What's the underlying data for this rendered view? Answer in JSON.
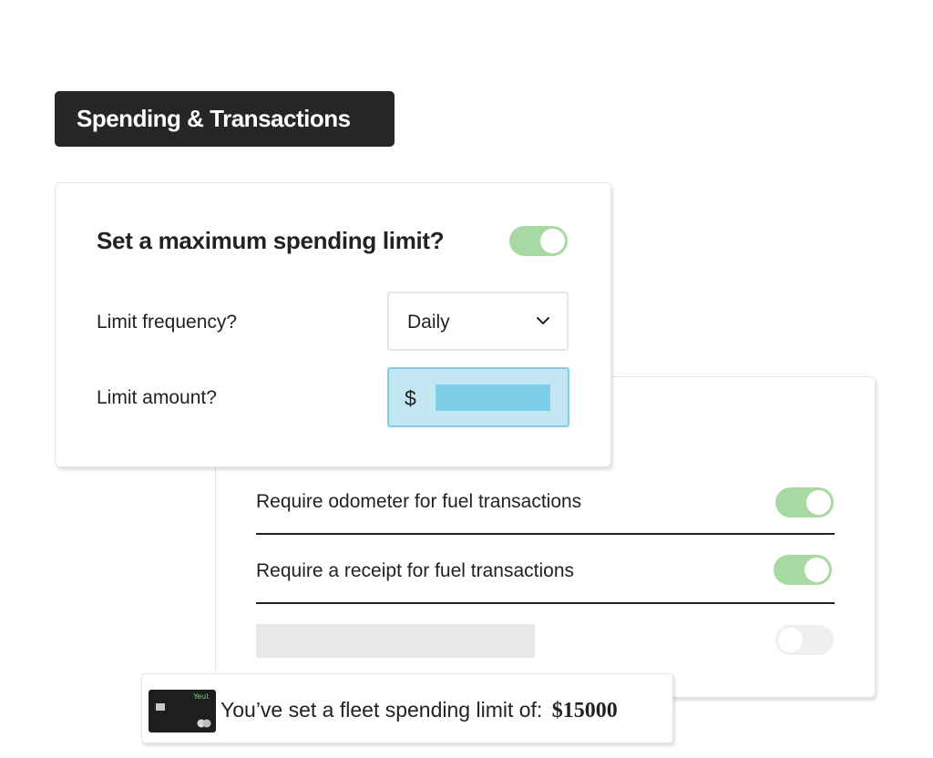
{
  "section": {
    "title": "Spending & Transactions"
  },
  "spending_limit": {
    "title": "Set a maximum spending limit?",
    "enabled": true,
    "frequency_label": "Limit frequency?",
    "frequency_value": "Daily",
    "amount_label": "Limit amount?",
    "currency_symbol": "$"
  },
  "fuel_rules": {
    "items": [
      {
        "label": "Require odometer for fuel transactions",
        "enabled": true
      },
      {
        "label": "Require a receipt for fuel transactions",
        "enabled": true
      }
    ],
    "third_toggle_enabled": false
  },
  "notice": {
    "card_brand": "Yeul.",
    "text": "You’ve set a fleet spending limit of:",
    "amount": "$15000"
  },
  "colors": {
    "tag_background": "#242724",
    "toggle_on": "#a9d9a3",
    "toggle_off": "#eeefef",
    "amount_field_bg": "#c3e7f2",
    "amount_field_border": "#86cde4"
  }
}
